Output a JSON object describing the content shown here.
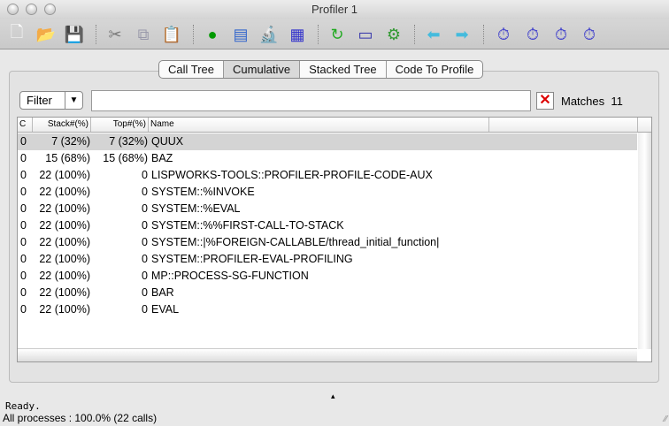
{
  "window": {
    "title": "Profiler 1"
  },
  "toolbar": {
    "icons": [
      "new-file-icon",
      "open-folder-icon",
      "save-icon",
      "cut-icon",
      "copy-icon",
      "paste-icon",
      "profile-icon",
      "profile-list-icon",
      "inspect-icon",
      "tree-icon",
      "refresh-icon",
      "windows-icon",
      "settings-icon",
      "back-arrow-icon",
      "forward-arrow-icon",
      "profile-doc-icon",
      "profile-config-icon",
      "profile-go-icon",
      "profile-stop-icon"
    ]
  },
  "tabs": [
    "Call Tree",
    "Cumulative",
    "Stacked Tree",
    "Code To Profile"
  ],
  "active_tab": "Cumulative",
  "filter": {
    "label": "Filter",
    "value": "",
    "matches_label": "Matches",
    "matches_count": "11"
  },
  "table": {
    "columns": [
      "C",
      "Stack#(%)",
      "Top#(%)",
      "Name"
    ],
    "rows": [
      {
        "c": "0",
        "stack": "7 (32%)",
        "top": "7 (32%)",
        "name": "QUUX"
      },
      {
        "c": "0",
        "stack": "15 (68%)",
        "top": "15 (68%)",
        "name": "BAZ"
      },
      {
        "c": "0",
        "stack": "22 (100%)",
        "top": "0",
        "name": "LISPWORKS-TOOLS::PROFILER-PROFILE-CODE-AUX"
      },
      {
        "c": "0",
        "stack": "22 (100%)",
        "top": "0",
        "name": "SYSTEM::%INVOKE"
      },
      {
        "c": "0",
        "stack": "22 (100%)",
        "top": "0",
        "name": "SYSTEM::%EVAL"
      },
      {
        "c": "0",
        "stack": "22 (100%)",
        "top": "0",
        "name": "SYSTEM::%%FIRST-CALL-TO-STACK"
      },
      {
        "c": "0",
        "stack": "22 (100%)",
        "top": "0",
        "name": "SYSTEM::|%FOREIGN-CALLABLE/thread_initial_function|"
      },
      {
        "c": "0",
        "stack": "22 (100%)",
        "top": "0",
        "name": "SYSTEM::PROFILER-EVAL-PROFILING"
      },
      {
        "c": "0",
        "stack": "22 (100%)",
        "top": "0",
        "name": "MP::PROCESS-SG-FUNCTION"
      },
      {
        "c": "0",
        "stack": "22 (100%)",
        "top": "0",
        "name": "BAR"
      },
      {
        "c": "0",
        "stack": "22 (100%)",
        "top": "0",
        "name": "EVAL"
      }
    ]
  },
  "status": {
    "line1": "Ready.",
    "line2": "All processes :  100.0% (22 calls)"
  }
}
